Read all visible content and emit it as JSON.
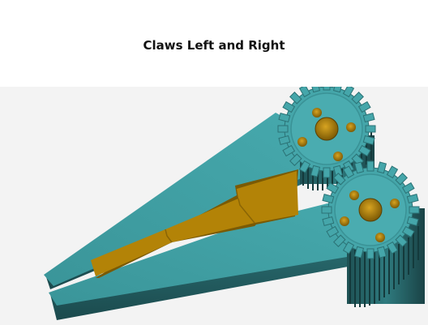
{
  "title": "Claws Left and Right",
  "model": {
    "body_color": "#3f9ea2",
    "body_shadow_color": "#1f5357",
    "insert_color": "#b38307",
    "insert_shadow_color": "#7a5a04",
    "viewport_background": "#f3f3f3",
    "gear_icon_name": "spur-gear-icon"
  }
}
